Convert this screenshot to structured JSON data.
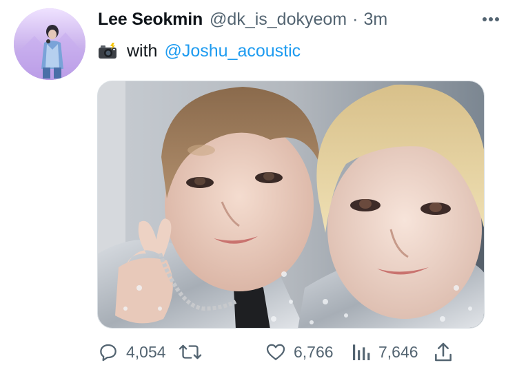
{
  "tweet": {
    "display_name": "Lee Seokmin",
    "handle": "@dk_is_dokyeom",
    "separator": "·",
    "time": "3m",
    "text_prefix": "with",
    "mention": "@Joshu_acoustic"
  },
  "icons": {
    "more": "more-horizontal-icon",
    "camera": "camera-with-flash-emoji",
    "reply": "reply-icon",
    "retweet": "retweet-icon",
    "like": "like-heart-icon",
    "views": "views-bar-chart-icon",
    "share": "share-icon"
  },
  "actions": {
    "replies": "4,054",
    "likes": "6,766",
    "views": "7,646"
  },
  "colors": {
    "link": "#1d9bf0",
    "secondary_text": "#536471",
    "primary_text": "#0f1419"
  }
}
